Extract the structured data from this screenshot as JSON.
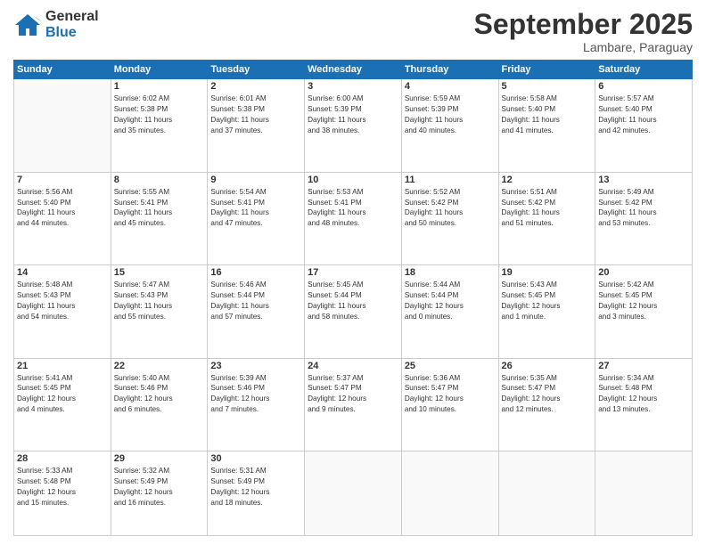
{
  "logo": {
    "line1": "General",
    "line2": "Blue"
  },
  "title": "September 2025",
  "subtitle": "Lambare, Paraguay",
  "days_of_week": [
    "Sunday",
    "Monday",
    "Tuesday",
    "Wednesday",
    "Thursday",
    "Friday",
    "Saturday"
  ],
  "weeks": [
    [
      {
        "day": "",
        "info": ""
      },
      {
        "day": "1",
        "info": "Sunrise: 6:02 AM\nSunset: 5:38 PM\nDaylight: 11 hours\nand 35 minutes."
      },
      {
        "day": "2",
        "info": "Sunrise: 6:01 AM\nSunset: 5:38 PM\nDaylight: 11 hours\nand 37 minutes."
      },
      {
        "day": "3",
        "info": "Sunrise: 6:00 AM\nSunset: 5:39 PM\nDaylight: 11 hours\nand 38 minutes."
      },
      {
        "day": "4",
        "info": "Sunrise: 5:59 AM\nSunset: 5:39 PM\nDaylight: 11 hours\nand 40 minutes."
      },
      {
        "day": "5",
        "info": "Sunrise: 5:58 AM\nSunset: 5:40 PM\nDaylight: 11 hours\nand 41 minutes."
      },
      {
        "day": "6",
        "info": "Sunrise: 5:57 AM\nSunset: 5:40 PM\nDaylight: 11 hours\nand 42 minutes."
      }
    ],
    [
      {
        "day": "7",
        "info": "Sunrise: 5:56 AM\nSunset: 5:40 PM\nDaylight: 11 hours\nand 44 minutes."
      },
      {
        "day": "8",
        "info": "Sunrise: 5:55 AM\nSunset: 5:41 PM\nDaylight: 11 hours\nand 45 minutes."
      },
      {
        "day": "9",
        "info": "Sunrise: 5:54 AM\nSunset: 5:41 PM\nDaylight: 11 hours\nand 47 minutes."
      },
      {
        "day": "10",
        "info": "Sunrise: 5:53 AM\nSunset: 5:41 PM\nDaylight: 11 hours\nand 48 minutes."
      },
      {
        "day": "11",
        "info": "Sunrise: 5:52 AM\nSunset: 5:42 PM\nDaylight: 11 hours\nand 50 minutes."
      },
      {
        "day": "12",
        "info": "Sunrise: 5:51 AM\nSunset: 5:42 PM\nDaylight: 11 hours\nand 51 minutes."
      },
      {
        "day": "13",
        "info": "Sunrise: 5:49 AM\nSunset: 5:42 PM\nDaylight: 11 hours\nand 53 minutes."
      }
    ],
    [
      {
        "day": "14",
        "info": "Sunrise: 5:48 AM\nSunset: 5:43 PM\nDaylight: 11 hours\nand 54 minutes."
      },
      {
        "day": "15",
        "info": "Sunrise: 5:47 AM\nSunset: 5:43 PM\nDaylight: 11 hours\nand 55 minutes."
      },
      {
        "day": "16",
        "info": "Sunrise: 5:46 AM\nSunset: 5:44 PM\nDaylight: 11 hours\nand 57 minutes."
      },
      {
        "day": "17",
        "info": "Sunrise: 5:45 AM\nSunset: 5:44 PM\nDaylight: 11 hours\nand 58 minutes."
      },
      {
        "day": "18",
        "info": "Sunrise: 5:44 AM\nSunset: 5:44 PM\nDaylight: 12 hours\nand 0 minutes."
      },
      {
        "day": "19",
        "info": "Sunrise: 5:43 AM\nSunset: 5:45 PM\nDaylight: 12 hours\nand 1 minute."
      },
      {
        "day": "20",
        "info": "Sunrise: 5:42 AM\nSunset: 5:45 PM\nDaylight: 12 hours\nand 3 minutes."
      }
    ],
    [
      {
        "day": "21",
        "info": "Sunrise: 5:41 AM\nSunset: 5:45 PM\nDaylight: 12 hours\nand 4 minutes."
      },
      {
        "day": "22",
        "info": "Sunrise: 5:40 AM\nSunset: 5:46 PM\nDaylight: 12 hours\nand 6 minutes."
      },
      {
        "day": "23",
        "info": "Sunrise: 5:39 AM\nSunset: 5:46 PM\nDaylight: 12 hours\nand 7 minutes."
      },
      {
        "day": "24",
        "info": "Sunrise: 5:37 AM\nSunset: 5:47 PM\nDaylight: 12 hours\nand 9 minutes."
      },
      {
        "day": "25",
        "info": "Sunrise: 5:36 AM\nSunset: 5:47 PM\nDaylight: 12 hours\nand 10 minutes."
      },
      {
        "day": "26",
        "info": "Sunrise: 5:35 AM\nSunset: 5:47 PM\nDaylight: 12 hours\nand 12 minutes."
      },
      {
        "day": "27",
        "info": "Sunrise: 5:34 AM\nSunset: 5:48 PM\nDaylight: 12 hours\nand 13 minutes."
      }
    ],
    [
      {
        "day": "28",
        "info": "Sunrise: 5:33 AM\nSunset: 5:48 PM\nDaylight: 12 hours\nand 15 minutes."
      },
      {
        "day": "29",
        "info": "Sunrise: 5:32 AM\nSunset: 5:49 PM\nDaylight: 12 hours\nand 16 minutes."
      },
      {
        "day": "30",
        "info": "Sunrise: 5:31 AM\nSunset: 5:49 PM\nDaylight: 12 hours\nand 18 minutes."
      },
      {
        "day": "",
        "info": ""
      },
      {
        "day": "",
        "info": ""
      },
      {
        "day": "",
        "info": ""
      },
      {
        "day": "",
        "info": ""
      }
    ]
  ]
}
